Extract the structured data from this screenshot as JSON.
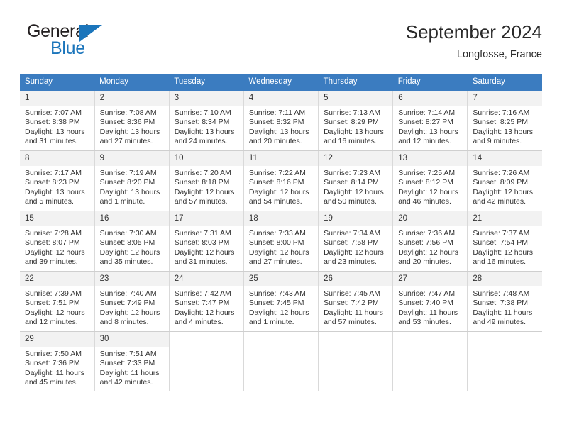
{
  "brand": {
    "name_top": "General",
    "name_bottom": "Blue",
    "accent_color": "#1b75bb"
  },
  "header": {
    "title": "September 2024",
    "subtitle": "Longfosse, France"
  },
  "theme": {
    "header_row_bg": "#3b7cc0",
    "header_row_text": "#ffffff",
    "daynum_bg": "#f2f2f2",
    "grid_line": "#d9d9d9",
    "text": "#333333"
  },
  "weekdays": [
    "Sunday",
    "Monday",
    "Tuesday",
    "Wednesday",
    "Thursday",
    "Friday",
    "Saturday"
  ],
  "weeks": [
    [
      {
        "day": "1",
        "sunrise": "Sunrise: 7:07 AM",
        "sunset": "Sunset: 8:38 PM",
        "daylight1": "Daylight: 13 hours",
        "daylight2": "and 31 minutes."
      },
      {
        "day": "2",
        "sunrise": "Sunrise: 7:08 AM",
        "sunset": "Sunset: 8:36 PM",
        "daylight1": "Daylight: 13 hours",
        "daylight2": "and 27 minutes."
      },
      {
        "day": "3",
        "sunrise": "Sunrise: 7:10 AM",
        "sunset": "Sunset: 8:34 PM",
        "daylight1": "Daylight: 13 hours",
        "daylight2": "and 24 minutes."
      },
      {
        "day": "4",
        "sunrise": "Sunrise: 7:11 AM",
        "sunset": "Sunset: 8:32 PM",
        "daylight1": "Daylight: 13 hours",
        "daylight2": "and 20 minutes."
      },
      {
        "day": "5",
        "sunrise": "Sunrise: 7:13 AM",
        "sunset": "Sunset: 8:29 PM",
        "daylight1": "Daylight: 13 hours",
        "daylight2": "and 16 minutes."
      },
      {
        "day": "6",
        "sunrise": "Sunrise: 7:14 AM",
        "sunset": "Sunset: 8:27 PM",
        "daylight1": "Daylight: 13 hours",
        "daylight2": "and 12 minutes."
      },
      {
        "day": "7",
        "sunrise": "Sunrise: 7:16 AM",
        "sunset": "Sunset: 8:25 PM",
        "daylight1": "Daylight: 13 hours",
        "daylight2": "and 9 minutes."
      }
    ],
    [
      {
        "day": "8",
        "sunrise": "Sunrise: 7:17 AM",
        "sunset": "Sunset: 8:23 PM",
        "daylight1": "Daylight: 13 hours",
        "daylight2": "and 5 minutes."
      },
      {
        "day": "9",
        "sunrise": "Sunrise: 7:19 AM",
        "sunset": "Sunset: 8:20 PM",
        "daylight1": "Daylight: 13 hours",
        "daylight2": "and 1 minute."
      },
      {
        "day": "10",
        "sunrise": "Sunrise: 7:20 AM",
        "sunset": "Sunset: 8:18 PM",
        "daylight1": "Daylight: 12 hours",
        "daylight2": "and 57 minutes."
      },
      {
        "day": "11",
        "sunrise": "Sunrise: 7:22 AM",
        "sunset": "Sunset: 8:16 PM",
        "daylight1": "Daylight: 12 hours",
        "daylight2": "and 54 minutes."
      },
      {
        "day": "12",
        "sunrise": "Sunrise: 7:23 AM",
        "sunset": "Sunset: 8:14 PM",
        "daylight1": "Daylight: 12 hours",
        "daylight2": "and 50 minutes."
      },
      {
        "day": "13",
        "sunrise": "Sunrise: 7:25 AM",
        "sunset": "Sunset: 8:12 PM",
        "daylight1": "Daylight: 12 hours",
        "daylight2": "and 46 minutes."
      },
      {
        "day": "14",
        "sunrise": "Sunrise: 7:26 AM",
        "sunset": "Sunset: 8:09 PM",
        "daylight1": "Daylight: 12 hours",
        "daylight2": "and 42 minutes."
      }
    ],
    [
      {
        "day": "15",
        "sunrise": "Sunrise: 7:28 AM",
        "sunset": "Sunset: 8:07 PM",
        "daylight1": "Daylight: 12 hours",
        "daylight2": "and 39 minutes."
      },
      {
        "day": "16",
        "sunrise": "Sunrise: 7:30 AM",
        "sunset": "Sunset: 8:05 PM",
        "daylight1": "Daylight: 12 hours",
        "daylight2": "and 35 minutes."
      },
      {
        "day": "17",
        "sunrise": "Sunrise: 7:31 AM",
        "sunset": "Sunset: 8:03 PM",
        "daylight1": "Daylight: 12 hours",
        "daylight2": "and 31 minutes."
      },
      {
        "day": "18",
        "sunrise": "Sunrise: 7:33 AM",
        "sunset": "Sunset: 8:00 PM",
        "daylight1": "Daylight: 12 hours",
        "daylight2": "and 27 minutes."
      },
      {
        "day": "19",
        "sunrise": "Sunrise: 7:34 AM",
        "sunset": "Sunset: 7:58 PM",
        "daylight1": "Daylight: 12 hours",
        "daylight2": "and 23 minutes."
      },
      {
        "day": "20",
        "sunrise": "Sunrise: 7:36 AM",
        "sunset": "Sunset: 7:56 PM",
        "daylight1": "Daylight: 12 hours",
        "daylight2": "and 20 minutes."
      },
      {
        "day": "21",
        "sunrise": "Sunrise: 7:37 AM",
        "sunset": "Sunset: 7:54 PM",
        "daylight1": "Daylight: 12 hours",
        "daylight2": "and 16 minutes."
      }
    ],
    [
      {
        "day": "22",
        "sunrise": "Sunrise: 7:39 AM",
        "sunset": "Sunset: 7:51 PM",
        "daylight1": "Daylight: 12 hours",
        "daylight2": "and 12 minutes."
      },
      {
        "day": "23",
        "sunrise": "Sunrise: 7:40 AM",
        "sunset": "Sunset: 7:49 PM",
        "daylight1": "Daylight: 12 hours",
        "daylight2": "and 8 minutes."
      },
      {
        "day": "24",
        "sunrise": "Sunrise: 7:42 AM",
        "sunset": "Sunset: 7:47 PM",
        "daylight1": "Daylight: 12 hours",
        "daylight2": "and 4 minutes."
      },
      {
        "day": "25",
        "sunrise": "Sunrise: 7:43 AM",
        "sunset": "Sunset: 7:45 PM",
        "daylight1": "Daylight: 12 hours",
        "daylight2": "and 1 minute."
      },
      {
        "day": "26",
        "sunrise": "Sunrise: 7:45 AM",
        "sunset": "Sunset: 7:42 PM",
        "daylight1": "Daylight: 11 hours",
        "daylight2": "and 57 minutes."
      },
      {
        "day": "27",
        "sunrise": "Sunrise: 7:47 AM",
        "sunset": "Sunset: 7:40 PM",
        "daylight1": "Daylight: 11 hours",
        "daylight2": "and 53 minutes."
      },
      {
        "day": "28",
        "sunrise": "Sunrise: 7:48 AM",
        "sunset": "Sunset: 7:38 PM",
        "daylight1": "Daylight: 11 hours",
        "daylight2": "and 49 minutes."
      }
    ],
    [
      {
        "day": "29",
        "sunrise": "Sunrise: 7:50 AM",
        "sunset": "Sunset: 7:36 PM",
        "daylight1": "Daylight: 11 hours",
        "daylight2": "and 45 minutes."
      },
      {
        "day": "30",
        "sunrise": "Sunrise: 7:51 AM",
        "sunset": "Sunset: 7:33 PM",
        "daylight1": "Daylight: 11 hours",
        "daylight2": "and 42 minutes."
      },
      {
        "day": "",
        "sunrise": "",
        "sunset": "",
        "daylight1": "",
        "daylight2": ""
      },
      {
        "day": "",
        "sunrise": "",
        "sunset": "",
        "daylight1": "",
        "daylight2": ""
      },
      {
        "day": "",
        "sunrise": "",
        "sunset": "",
        "daylight1": "",
        "daylight2": ""
      },
      {
        "day": "",
        "sunrise": "",
        "sunset": "",
        "daylight1": "",
        "daylight2": ""
      },
      {
        "day": "",
        "sunrise": "",
        "sunset": "",
        "daylight1": "",
        "daylight2": ""
      }
    ]
  ]
}
